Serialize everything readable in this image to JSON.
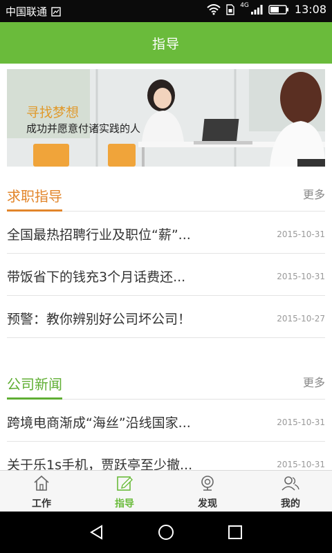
{
  "status_bar": {
    "carrier": "中国联通",
    "time": "13:08",
    "network": "4G",
    "icons": [
      "image-icon",
      "wifi-icon",
      "sim-icon",
      "signal-icon",
      "battery-icon"
    ]
  },
  "header": {
    "title": "指导"
  },
  "banner": {
    "title": "寻找梦想",
    "subtitle": "成功并愿意付诸实践的人"
  },
  "sections": [
    {
      "title": "求职指导",
      "more": "更多",
      "accent": "#e2852a",
      "items": [
        {
          "title": "全国最热招聘行业及职位“薪”...",
          "date": "2015-10-31"
        },
        {
          "title": "带饭省下的钱充3个月话费还...",
          "date": "2015-10-31"
        },
        {
          "title": "预警：教你辨别好公司坏公司！",
          "date": "2015-10-27"
        }
      ]
    },
    {
      "title": "公司新闻",
      "more": "更多",
      "accent": "#5fae33",
      "items": [
        {
          "title": "跨境电商渐成“海丝”沿线国家...",
          "date": "2015-10-31"
        },
        {
          "title": "关于乐1s手机，贾跃亭至少撤...",
          "date": "2015-10-31"
        }
      ]
    }
  ],
  "tabs": [
    {
      "label": "工作",
      "icon": "home-icon",
      "active": false
    },
    {
      "label": "指导",
      "icon": "edit-icon",
      "active": true
    },
    {
      "label": "发现",
      "icon": "camera-icon",
      "active": false
    },
    {
      "label": "我的",
      "icon": "users-icon",
      "active": false
    }
  ],
  "colors": {
    "primary": "#6abb3b",
    "orange_accent": "#e2852a",
    "green_accent": "#5fae33"
  },
  "nav_buttons": [
    "back-icon",
    "home-circle-icon",
    "recents-icon"
  ]
}
